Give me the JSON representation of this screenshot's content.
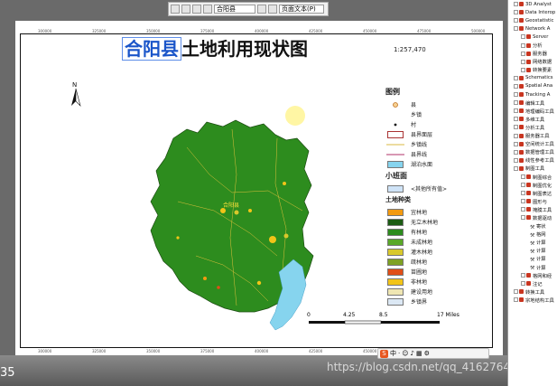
{
  "toolbar": {
    "page_select": "合阳县",
    "page_text_button": "页面文本(P)"
  },
  "map": {
    "title_county": "合阳县",
    "title_rest": "土地利用现状图",
    "scale_ratio": "1:257,470",
    "north_label": "N",
    "county_seat_label": "合阳县",
    "frame_ticks": [
      "300000",
      "325000",
      "350000",
      "375000",
      "400000",
      "425000",
      "450000",
      "475000",
      "500000"
    ]
  },
  "legend": {
    "heading": "图例",
    "items": [
      {
        "label": "县",
        "symbol": "county-point-icon"
      },
      {
        "label": "乡镇",
        "symbol": "town-point-icon"
      },
      {
        "label": "村",
        "symbol": "village-point-icon"
      },
      {
        "label": "县界面层",
        "symbol": "boundary-polygon"
      },
      {
        "label": "乡镇线",
        "symbol": "town-line"
      },
      {
        "label": "县界线",
        "symbol": "county-line"
      },
      {
        "label": "湖泊水面",
        "symbol": "water-fill"
      }
    ],
    "small_class_heading": "小班面",
    "small_class_item": "<其他所有值>",
    "landuse_heading": "土地种类",
    "landuse_items": [
      {
        "label": "宜林地",
        "color": "#f39a10"
      },
      {
        "label": "无立木林地",
        "color": "#1c5c14"
      },
      {
        "label": "有林地",
        "color": "#2d8c1e"
      },
      {
        "label": "未成林地",
        "color": "#5aa828"
      },
      {
        "label": "灌木林地",
        "color": "#d8c82c"
      },
      {
        "label": "疏林地",
        "color": "#7ea124"
      },
      {
        "label": "苗圃地",
        "color": "#e04e18"
      },
      {
        "label": "非林地",
        "color": "#f2c418"
      },
      {
        "label": "建设用地",
        "color": "#efe6b2"
      },
      {
        "label": "乡镇界",
        "color": "#dce8f4"
      }
    ]
  },
  "scalebar": {
    "ticks": [
      "0",
      "4.25",
      "8.5",
      "17 Miles"
    ]
  },
  "sidebar": {
    "items": [
      {
        "label": "3D Analyst",
        "type": "toolbox"
      },
      {
        "label": "Data Interop",
        "type": "toolbox"
      },
      {
        "label": "Geostatistic",
        "type": "toolbox"
      },
      {
        "label": "Network A",
        "type": "toolbox"
      },
      {
        "label": "Server",
        "type": "toolset"
      },
      {
        "label": "分析",
        "type": "toolset"
      },
      {
        "label": "服务器",
        "type": "toolset"
      },
      {
        "label": "网络数据",
        "type": "toolset"
      },
      {
        "label": "转换要素",
        "type": "toolset"
      },
      {
        "label": "Schematics",
        "type": "toolbox"
      },
      {
        "label": "Spatial Ana",
        "type": "toolbox"
      },
      {
        "label": "Tracking A",
        "type": "toolbox"
      },
      {
        "label": "编辑工具",
        "type": "toolbox"
      },
      {
        "label": "地理编码工具",
        "type": "toolbox"
      },
      {
        "label": "多维工具",
        "type": "toolbox"
      },
      {
        "label": "分析工具",
        "type": "toolbox"
      },
      {
        "label": "服务器工具",
        "type": "toolbox"
      },
      {
        "label": "空间统计工具",
        "type": "toolbox"
      },
      {
        "label": "数据管理工具",
        "type": "toolbox"
      },
      {
        "label": "线性参考工具",
        "type": "toolbox"
      },
      {
        "label": "制图工具",
        "type": "toolbox"
      },
      {
        "label": "制图综合",
        "type": "toolset"
      },
      {
        "label": "制图优化",
        "type": "toolset"
      },
      {
        "label": "制图表达",
        "type": "toolset"
      },
      {
        "label": "图形与",
        "type": "toolset"
      },
      {
        "label": "掩膜工具",
        "type": "toolset"
      },
      {
        "label": "数据驱动",
        "type": "toolset"
      },
      {
        "label": "寄状",
        "type": "tool"
      },
      {
        "label": "格网",
        "type": "tool"
      },
      {
        "label": "计算",
        "type": "tool"
      },
      {
        "label": "计算",
        "type": "tool"
      },
      {
        "label": "计算",
        "type": "tool"
      },
      {
        "label": "计算",
        "type": "tool"
      },
      {
        "label": "格网和经",
        "type": "toolset"
      },
      {
        "label": "注记",
        "type": "toolset"
      },
      {
        "label": "转换工具",
        "type": "toolbox"
      },
      {
        "label": "宗地结构工具",
        "type": "toolbox"
      }
    ]
  },
  "footer": {
    "page_number": "35",
    "watermark": "https://blog.csdn.net/qq_41627642"
  },
  "ime": {
    "logo": "S",
    "mode": "中"
  }
}
